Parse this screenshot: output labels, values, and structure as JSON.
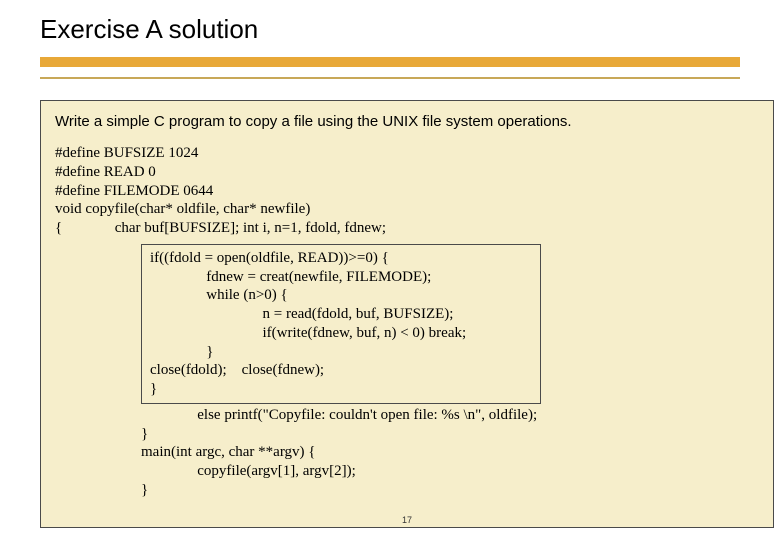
{
  "title": "Exercise A solution",
  "prompt": "Write a simple C program to copy a file using the UNIX file system operations.",
  "code_block_1": "#define BUFSIZE 1024\n#define READ 0\n#define FILEMODE 0644\nvoid copyfile(char* oldfile, char* newfile)\n{              char buf[BUFSIZE]; int i, n=1, fdold, fdnew;",
  "inner_code": "if((fdold = open(oldfile, READ))>=0) {\n               fdnew = creat(newfile, FILEMODE);\n               while (n>0) {\n                              n = read(fdold, buf, BUFSIZE);\n                              if(write(fdnew, buf, n) < 0) break;\n               }\nclose(fdold);    close(fdnew);\n}",
  "code_block_2": "               else printf(\"Copyfile: couldn't open file: %s \\n\", oldfile);\n}\nmain(int argc, char **argv) {\n               copyfile(argv[1], argv[2]);\n}",
  "page_number": "17"
}
